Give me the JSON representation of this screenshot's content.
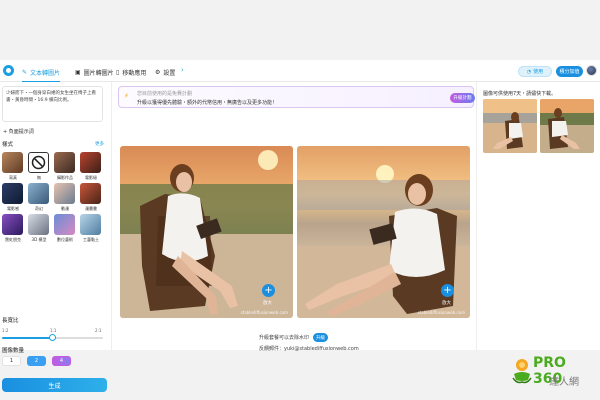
{
  "header": {
    "tabs": [
      {
        "label": "文本轉圖片",
        "icon": "text-to-image-icon"
      },
      {
        "label": "圖片轉圖片",
        "icon": "image-to-image-icon"
      },
      {
        "label": "移動應用",
        "icon": "mobile-icon"
      },
      {
        "label": "設置",
        "icon": "gear-icon"
      }
    ],
    "credits_label": "使用",
    "buy_label": "積分加值"
  },
  "sidebar": {
    "prompt_text": "少婦而下・一個身穿白裙的女生坐在椅子上看書・黃昏時間・16:9 橫向比例。",
    "negative_prompt_label": "負面提示詞",
    "style_label": "樣式",
    "more_label": "更多",
    "styles": [
      {
        "name": "寫真",
        "color1": "#b8875f",
        "color2": "#5e3b24"
      },
      {
        "name": "無",
        "color1": "#ffffff",
        "color2": "#ffffff"
      },
      {
        "name": "攝影作品",
        "color1": "#9a6a50",
        "color2": "#3c2a22"
      },
      {
        "name": "電影級",
        "color1": "#b9442f",
        "color2": "#3b1f18"
      },
      {
        "name": "電影感",
        "color1": "#2d3e66",
        "color2": "#0f1a33"
      },
      {
        "name": "奇幻",
        "color1": "#8ab0d0",
        "color2": "#3b5a78"
      },
      {
        "name": "動漫",
        "color1": "#e6c4b0",
        "color2": "#6a7a90"
      },
      {
        "name": "漫畫書",
        "color1": "#c9553a",
        "color2": "#482418"
      },
      {
        "name": "霓虹朋克",
        "color1": "#8a4fc2",
        "color2": "#2a1a5c"
      },
      {
        "name": "3D 模型",
        "color1": "#d8dde5",
        "color2": "#6a7180"
      },
      {
        "name": "數位藝術",
        "color1": "#6a8dd8",
        "color2": "#d68ac0"
      },
      {
        "name": "工藝黏土",
        "color1": "#b8d4e8",
        "color2": "#4f7ea0"
      }
    ],
    "ratio_label": "長寬比",
    "ratio_min": "1:2",
    "ratio_value": "1:1",
    "ratio_max": "2:1",
    "ratio_fraction": 0.5,
    "quantity_label": "圖像數量",
    "quantity_options": [
      "1",
      "2",
      "4"
    ],
    "quantity_selected_index": 1,
    "generate_label": "生成"
  },
  "main": {
    "banner_line1": "您目前使用的是免費計劃",
    "banner_line2": "升級以獲得優先體驗・額外的代幣信用・無廣告以及更多功能！",
    "upgrade_label": "升級計劃",
    "zoom_label": "放大",
    "watermark_text": "stablediffusionweb.com",
    "upgrade_watermark_text": "升級套餐可以去除水印",
    "upgrade_small_label": "升級",
    "feedback_text": "反饋郵件：yuki@stablediffusionweb.com"
  },
  "right_panel": {
    "title": "圖像可供使用7天・請儘快下載。"
  },
  "brand": {
    "name": "PRO 360",
    "sub": "達人網"
  },
  "colors": {
    "accent": "#1a9fe0",
    "brand_green": "#4aab1f"
  }
}
